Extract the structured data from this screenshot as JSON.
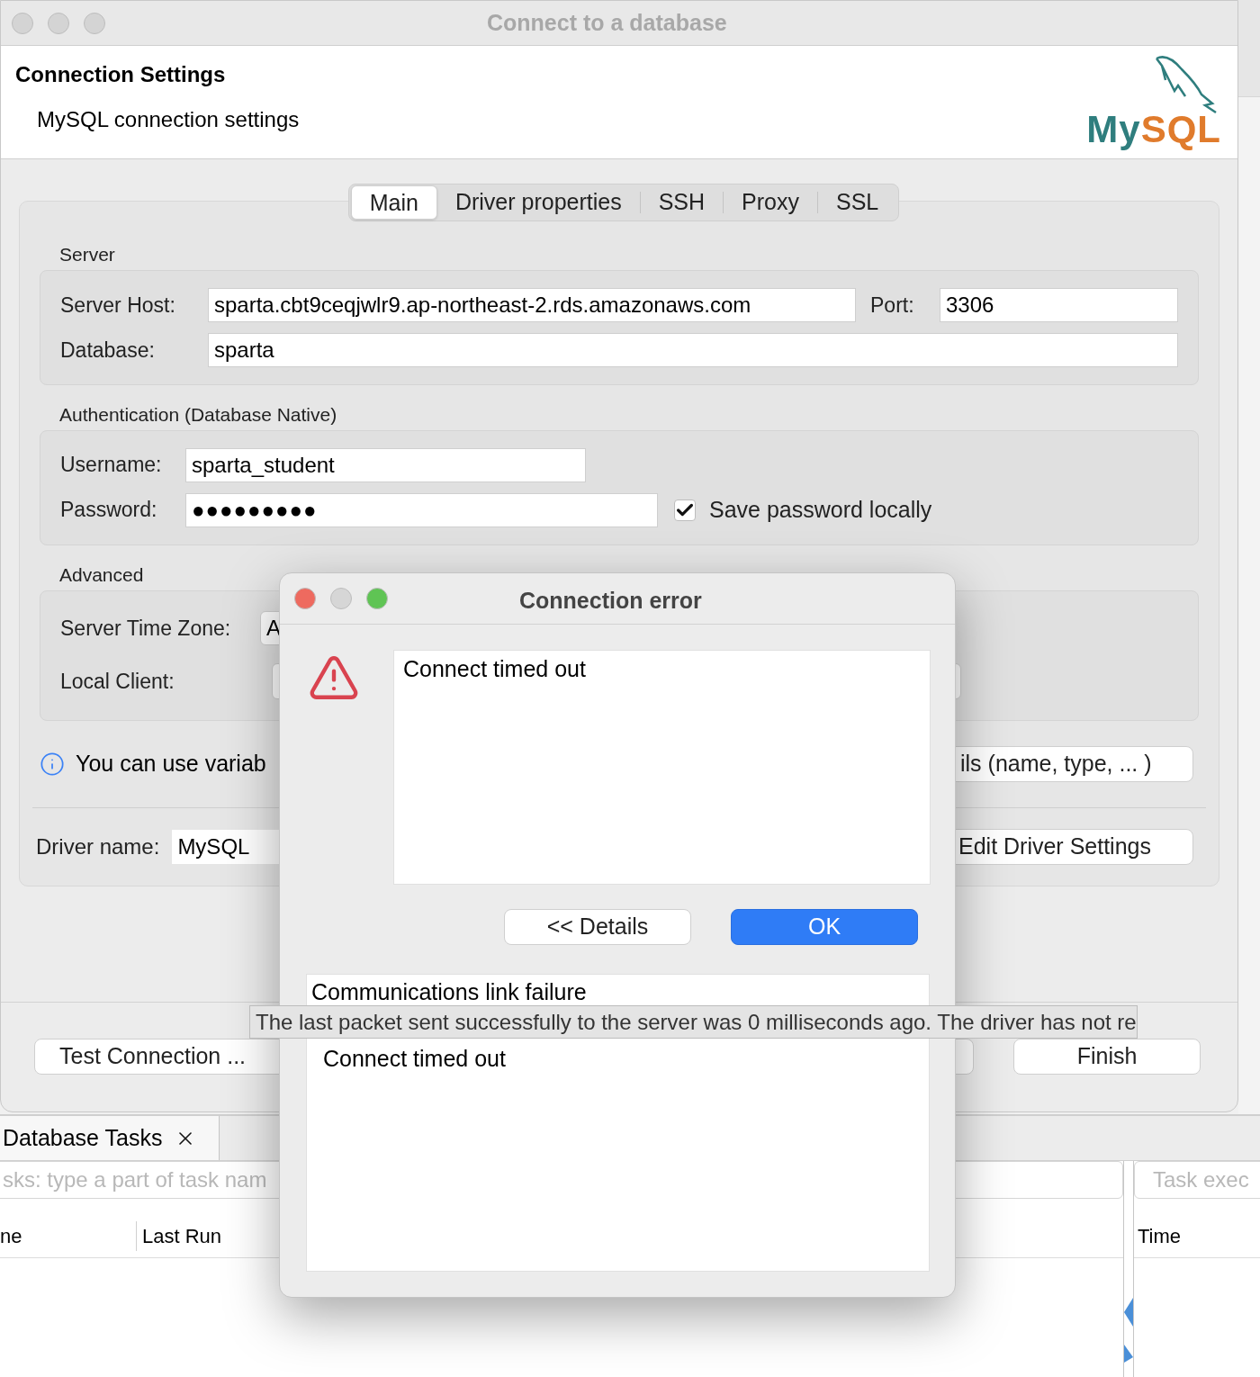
{
  "window": {
    "title": "Connect to a database"
  },
  "header": {
    "title": "Connection Settings",
    "subtitle": "MySQL connection settings"
  },
  "logo": {
    "primary": "My",
    "secondary": "SQL"
  },
  "tabs": [
    {
      "label": "Main",
      "selected": true
    },
    {
      "label": "Driver properties",
      "selected": false
    },
    {
      "label": "SSH",
      "selected": false
    },
    {
      "label": "Proxy",
      "selected": false
    },
    {
      "label": "SSL",
      "selected": false
    }
  ],
  "server": {
    "title": "Server",
    "host_label": "Server Host:",
    "host": "sparta.cbt9ceqjwlr9.ap-northeast-2.rds.amazonaws.com",
    "port_label": "Port:",
    "port": "3306",
    "database_label": "Database:",
    "database": "sparta"
  },
  "authentication": {
    "title": "Authentication (Database Native)",
    "username_label": "Username:",
    "username": "sparta_student",
    "password_label": "Password:",
    "password": "●●●●●●●●●",
    "save_password": {
      "label": "Save password locally",
      "checked": true
    }
  },
  "advanced": {
    "title": "Advanced",
    "time_zone_label": "Server Time Zone:",
    "time_zone": "A",
    "local_client_label": "Local Client:"
  },
  "info_text": "You can use variab",
  "details_button": "ils (name, type, ... )",
  "driver": {
    "label": "Driver name:",
    "value": "MySQL",
    "edit_button": "Edit Driver Settings"
  },
  "footer_buttons": [
    {
      "label": "Test Connection ..."
    },
    {
      "label": "Finish"
    }
  ],
  "tasks_panel": {
    "tab": "Database Tasks",
    "filter_placeholder": "sks: type a part of task nam",
    "columns": [
      "ne",
      "Last Run"
    ],
    "log_placeholder": "Task exec",
    "log_columns": [
      "Time"
    ]
  },
  "dialog": {
    "title": "Connection error",
    "message": "Connect timed out",
    "buttons": [
      {
        "label": "<< Details",
        "kind": "default"
      },
      {
        "label": "OK",
        "kind": "primary"
      }
    ],
    "details": [
      "Communications link failure",
      "Connect timed out"
    ]
  },
  "tooltip": "The last packet sent successfully to the server was 0 milliseconds ago. The driver has not re"
}
